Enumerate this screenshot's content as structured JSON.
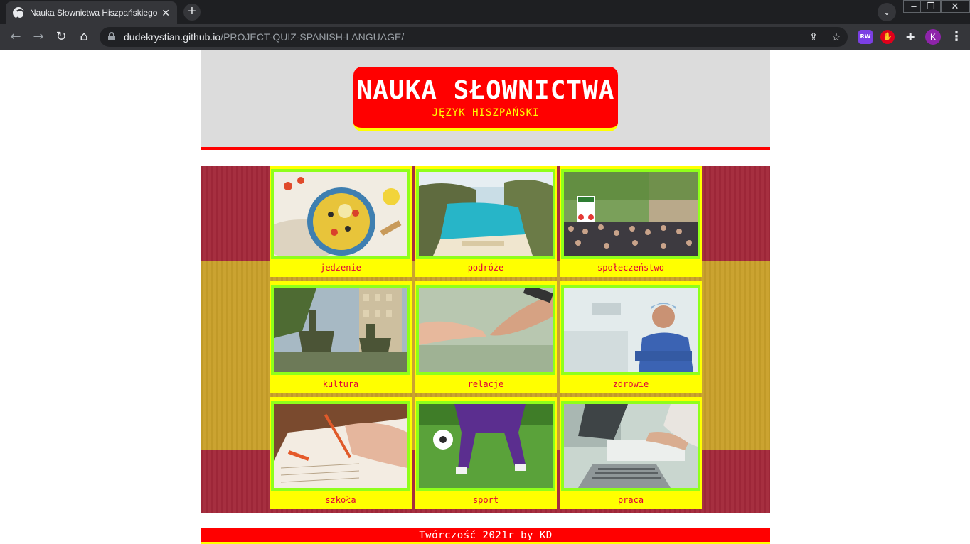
{
  "browser": {
    "tab_title": "Nauka Słownictwa Hiszpańskiego",
    "tab_close": "✕",
    "new_tab": "+",
    "url_host": "dudekrystian.github.io",
    "url_path": "/PROJECT-QUIZ-SPANISH-LANGUAGE/",
    "profile_initial": "K",
    "ext_rw": "RW"
  },
  "header": {
    "title": "NAUKA SŁOWNICTWA",
    "subtitle": "JĘZYK HISZPAŃSKI"
  },
  "categories": [
    {
      "label": "jedzenie",
      "image": "paella-photo"
    },
    {
      "label": "podróże",
      "image": "beach-cove-photo"
    },
    {
      "label": "społeczeństwo",
      "image": "crowd-street-photo"
    },
    {
      "label": "kultura",
      "image": "don-quixote-statue-photo"
    },
    {
      "label": "relacje",
      "image": "holding-hands-photo"
    },
    {
      "label": "zdrowie",
      "image": "doctor-photo"
    },
    {
      "label": "szkoła",
      "image": "child-writing-photo"
    },
    {
      "label": "sport",
      "image": "football-player-photo"
    },
    {
      "label": "praca",
      "image": "laptop-work-photo"
    }
  ],
  "footer": {
    "text": "Twórczość 2021r by KD"
  },
  "colors": {
    "header_bg": "#dcdcdc",
    "logo_red": "#ff0000",
    "accent_yellow": "#ffff00",
    "frame_green": "#8fff1a",
    "label_text": "#e0003a",
    "flag_red": "#a3283a",
    "flag_yellow": "#c9a02a"
  }
}
